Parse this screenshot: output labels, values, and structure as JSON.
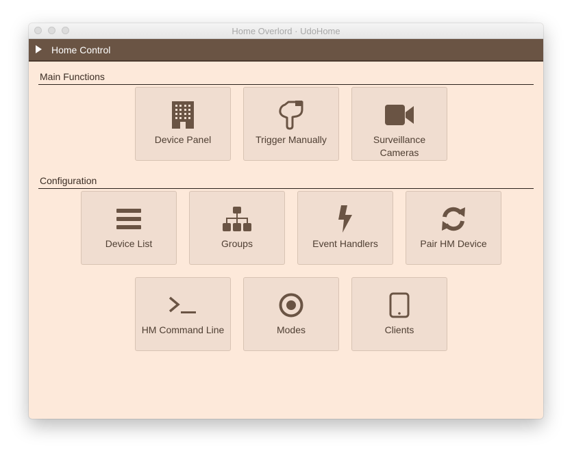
{
  "window": {
    "title": "Home Overlord · UdoHome"
  },
  "header": {
    "title": "Home Control"
  },
  "sections": {
    "main": {
      "title": "Main Functions"
    },
    "config": {
      "title": "Configuration"
    }
  },
  "tiles": {
    "device_panel": {
      "label": "Device Panel",
      "icon": "building-icon"
    },
    "trigger_manually": {
      "label": "Trigger Manually",
      "icon": "pointing-hand-icon"
    },
    "surveillance_cameras": {
      "label": "Surveillance Cameras",
      "icon": "video-camera-icon"
    },
    "device_list": {
      "label": "Device List",
      "icon": "list-icon"
    },
    "groups": {
      "label": "Groups",
      "icon": "sitemap-icon"
    },
    "event_handlers": {
      "label": "Event Handlers",
      "icon": "lightning-icon"
    },
    "pair_hm_device": {
      "label": "Pair HM Device",
      "icon": "refresh-icon"
    },
    "hm_command_line": {
      "label": "HM Command Line",
      "icon": "terminal-icon"
    },
    "modes": {
      "label": "Modes",
      "icon": "dot-circle-icon"
    },
    "clients": {
      "label": "Clients",
      "icon": "tablet-icon"
    }
  },
  "colors": {
    "header_bg": "#6a5444",
    "content_bg": "#fde9da",
    "tile_bg": "#f0ddd0",
    "icon": "#6a5444",
    "text": "#4e3e32"
  }
}
